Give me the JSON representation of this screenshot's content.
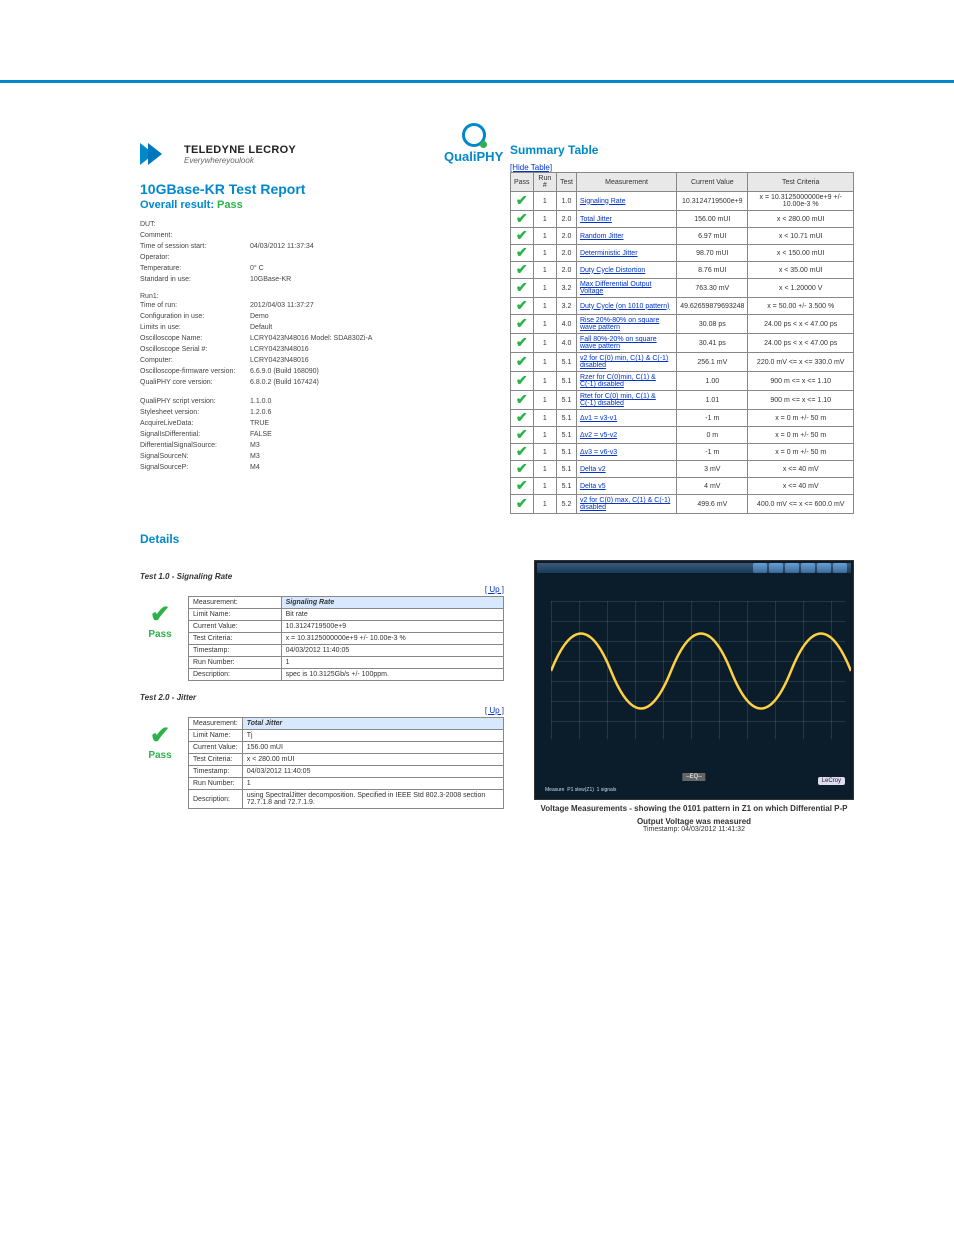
{
  "brand": {
    "name": "TELEDYNE LECROY",
    "tagline": "Everywhereyoulook",
    "qp": "QualiPHY"
  },
  "report": {
    "title": "10GBase-KR Test Report",
    "overall_label": "Overall result:",
    "overall_value": "Pass"
  },
  "meta1": [
    [
      "DUT:",
      ""
    ],
    [
      "Comment:",
      ""
    ],
    [
      "Time of session start:",
      "04/03/2012 11:37:34"
    ],
    [
      "Operator:",
      ""
    ],
    [
      "Temperature:",
      "0° C"
    ],
    [
      "Standard in use:",
      "10GBase-KR"
    ]
  ],
  "meta2_h": "Run1:",
  "meta2": [
    [
      "Time of run:",
      "2012/04/03 11:37:27"
    ],
    [
      "Configuration in use:",
      "Demo"
    ],
    [
      "Limits in use:",
      "Default"
    ],
    [
      "Oscilloscope Name:",
      "LCRY0423N48016 Model: SDA830Zi-A"
    ],
    [
      "Oscilloscope Serial #:",
      "LCRY0423N48016"
    ],
    [
      "Computer:",
      "LCRY0423N48016"
    ],
    [
      "Oscilloscope-firmware version:",
      "6.6.9.0 (Build 168090)"
    ],
    [
      "QualiPHY core version:",
      "6.8.0.2 (Build 167424)"
    ]
  ],
  "meta3": [
    [
      "QualiPHY script version:",
      "1.1.0.0"
    ],
    [
      "Stylesheet version:",
      "1.2.0.6"
    ],
    [
      "AcquireLiveData:",
      "TRUE"
    ],
    [
      "SignalIsDifferential:",
      "FALSE"
    ],
    [
      "DifferentialSignalSource:",
      "M3"
    ],
    [
      "SignalSourceN:",
      "M3"
    ],
    [
      "SignalSourceP:",
      "M4"
    ]
  ],
  "summary": {
    "heading": "Summary Table",
    "hide": "[Hide Table]",
    "headers": [
      "Pass",
      "Run #",
      "Test",
      "Measurement",
      "Current Value",
      "Test Criteria"
    ],
    "rows": [
      [
        "1",
        "1.0",
        "Signaling Rate",
        "10.3124719500e+9",
        "x = 10.3125000000e+9 +/- 10.00e-3 %"
      ],
      [
        "1",
        "2.0",
        "Total Jitter",
        "156.00 mUI",
        "x < 280.00 mUI"
      ],
      [
        "1",
        "2.0",
        "Random Jitter",
        "6.97 mUI",
        "x < 10.71 mUI"
      ],
      [
        "1",
        "2.0",
        "Deterministic Jitter",
        "98.70 mUI",
        "x < 150.00 mUI"
      ],
      [
        "1",
        "2.0",
        "Duty Cycle Distortion",
        "8.76 mUI",
        "x < 35.00 mUI"
      ],
      [
        "1",
        "3.2",
        "Max Differential Output Voltage",
        "763.30 mV",
        "x < 1.20000 V"
      ],
      [
        "1",
        "3.2",
        "Duty Cycle (on 1010 pattern)",
        "49.62659879693248",
        "x = 50.00 +/- 3.500 %"
      ],
      [
        "1",
        "4.0",
        "Rise 20%-80% on square wave pattern",
        "30.08 ps",
        "24.00 ps < x < 47.00 ps"
      ],
      [
        "1",
        "4.0",
        "Fall 80%-20% on square wave pattern",
        "30.41 ps",
        "24.00 ps < x < 47.00 ps"
      ],
      [
        "1",
        "5.1",
        "v2 for C(0) min, C(1) & C(-1) disabled",
        "256.1 mV",
        "220.0 mV <= x <= 330.0 mV"
      ],
      [
        "1",
        "5.1",
        "Rzer for C(0)min, C(1) & C(-1) disabled",
        "1.00",
        "900 m <= x <= 1.10"
      ],
      [
        "1",
        "5.1",
        "Rtet for C(0) min, C(1) & C(-1) disabled",
        "1.01",
        "900 m <= x <= 1.10"
      ],
      [
        "1",
        "5.1",
        "Δv1 = v3‑v1",
        "-1 m",
        "x = 0 m +/- 50 m"
      ],
      [
        "1",
        "5.1",
        "Δv2 = v5‑v2",
        "0 m",
        "x = 0 m +/- 50 m"
      ],
      [
        "1",
        "5.1",
        "Δv3 = v6‑v3",
        "-1 m",
        "x = 0 m +/- 50 m"
      ],
      [
        "1",
        "5.1",
        "Delta v2",
        "3 mV",
        "x <= 40 mV"
      ],
      [
        "1",
        "5.1",
        "Delta v5",
        "4 mV",
        "x <= 40 mV"
      ],
      [
        "1",
        "5.2",
        "v2 for C(0) max, C(1) & C(-1) disabled",
        "499.6 mV",
        "400.0 mV <= x <= 600.0 mV"
      ]
    ]
  },
  "details": {
    "heading": "Details",
    "up": "[ Up ]"
  },
  "test1": {
    "title": "Test 1.0 - Signaling Rate",
    "rows": [
      [
        "Measurement:",
        "Signaling Rate"
      ],
      [
        "Limit Name:",
        "Bit rate"
      ],
      [
        "Current Value:",
        "10.3124719500e+9"
      ],
      [
        "Test Criteria:",
        "x = 10.3125000000e+9 +/- 10.00e-3 %"
      ],
      [
        "Timestamp:",
        "04/03/2012 11:40:05"
      ],
      [
        "Run Number:",
        "1"
      ],
      [
        "Description:",
        "spec is 10.3125Gb/s +/- 100ppm."
      ]
    ]
  },
  "test2": {
    "title": "Test 2.0 - Jitter",
    "rows": [
      [
        "Measurement:",
        "Total Jitter"
      ],
      [
        "Limit Name:",
        "Tj"
      ],
      [
        "Current Value:",
        "156.00 mUI"
      ],
      [
        "Test Criteria:",
        "x < 280.00 mUI"
      ],
      [
        "Timestamp:",
        "04/03/2012 11:40:05"
      ],
      [
        "Run Number:",
        "1"
      ],
      [
        "Description:",
        "using SpectralJitter decomposition. Specified in IEEE Std 802.3-2008 section 72.7.1.8 and 72.7.1.9."
      ]
    ]
  },
  "caption": {
    "l1": "Voltage Measurements - showing the 0101 pattern in Z1 on which Differential P-P",
    "l2": "Output Voltage was measured",
    "l3": "Timestamp: 04/03/2012 11:41:32"
  },
  "pass_word": "Pass"
}
